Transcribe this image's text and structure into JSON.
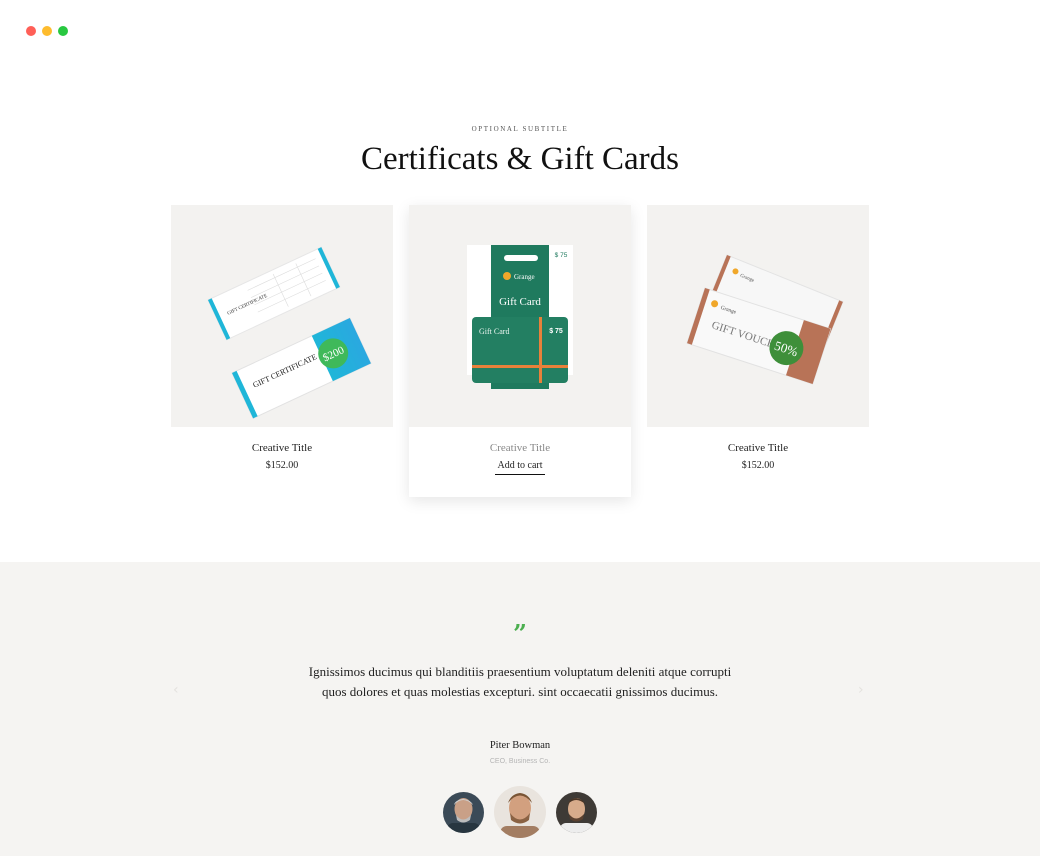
{
  "window": {
    "controls": [
      {
        "name": "close-dot",
        "color": "#ff5f57"
      },
      {
        "name": "minimize-dot",
        "color": "#febc2e"
      },
      {
        "name": "zoom-dot",
        "color": "#28c840"
      }
    ]
  },
  "section": {
    "subtitle": "OPTIONAL SUBTITLE",
    "title": "Certificats & Gift Cards"
  },
  "products": [
    {
      "title": "Creative Title",
      "price": "$152.00",
      "image_text": [
        "GIFT CERTIFICATE",
        "$200"
      ]
    },
    {
      "title": "Creative Title",
      "action": "Add to cart",
      "image_text": [
        "Grange",
        "Gift Card",
        "$ 75",
        "Gift Card",
        "$ 75"
      ]
    },
    {
      "title": "Creative Title",
      "price": "$152.00",
      "image_text": [
        "Grange",
        "GIFT VOUCHER",
        "50%"
      ]
    }
  ],
  "testimonial": {
    "quote_icon": "quote-icon",
    "text": "Ignissimos ducimus qui blanditiis praesentium voluptatum deleniti atque corrupti quos dolores et quas molestias excepturi. sint occaecatii gnissimos ducimus.",
    "author": "Piter Bowman",
    "role": "CEO, Business Co."
  },
  "colors": {
    "accent_green": "#4caf50",
    "card_green": "#1f7a5e",
    "voucher_copper": "#b87357",
    "cert_cyan": "#1fb6d8"
  }
}
